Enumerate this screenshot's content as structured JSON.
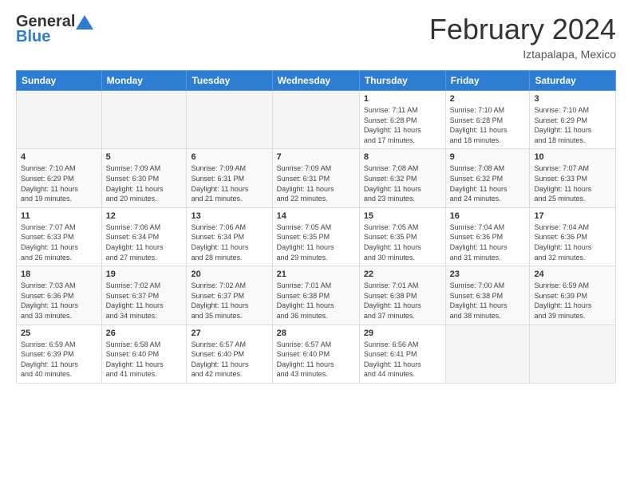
{
  "header": {
    "logo_general": "General",
    "logo_blue": "Blue",
    "main_title": "February 2024",
    "subtitle": "Iztapalapa, Mexico"
  },
  "days_of_week": [
    "Sunday",
    "Monday",
    "Tuesday",
    "Wednesday",
    "Thursday",
    "Friday",
    "Saturday"
  ],
  "weeks": [
    {
      "row_class": "row-1",
      "days": [
        {
          "number": "",
          "info": "",
          "empty": true
        },
        {
          "number": "",
          "info": "",
          "empty": true
        },
        {
          "number": "",
          "info": "",
          "empty": true
        },
        {
          "number": "",
          "info": "",
          "empty": true
        },
        {
          "number": "1",
          "info": "Sunrise: 7:11 AM\nSunset: 6:28 PM\nDaylight: 11 hours\nand 17 minutes.",
          "empty": false
        },
        {
          "number": "2",
          "info": "Sunrise: 7:10 AM\nSunset: 6:28 PM\nDaylight: 11 hours\nand 18 minutes.",
          "empty": false
        },
        {
          "number": "3",
          "info": "Sunrise: 7:10 AM\nSunset: 6:29 PM\nDaylight: 11 hours\nand 18 minutes.",
          "empty": false
        }
      ]
    },
    {
      "row_class": "row-2",
      "days": [
        {
          "number": "4",
          "info": "Sunrise: 7:10 AM\nSunset: 6:29 PM\nDaylight: 11 hours\nand 19 minutes.",
          "empty": false
        },
        {
          "number": "5",
          "info": "Sunrise: 7:09 AM\nSunset: 6:30 PM\nDaylight: 11 hours\nand 20 minutes.",
          "empty": false
        },
        {
          "number": "6",
          "info": "Sunrise: 7:09 AM\nSunset: 6:31 PM\nDaylight: 11 hours\nand 21 minutes.",
          "empty": false
        },
        {
          "number": "7",
          "info": "Sunrise: 7:09 AM\nSunset: 6:31 PM\nDaylight: 11 hours\nand 22 minutes.",
          "empty": false
        },
        {
          "number": "8",
          "info": "Sunrise: 7:08 AM\nSunset: 6:32 PM\nDaylight: 11 hours\nand 23 minutes.",
          "empty": false
        },
        {
          "number": "9",
          "info": "Sunrise: 7:08 AM\nSunset: 6:32 PM\nDaylight: 11 hours\nand 24 minutes.",
          "empty": false
        },
        {
          "number": "10",
          "info": "Sunrise: 7:07 AM\nSunset: 6:33 PM\nDaylight: 11 hours\nand 25 minutes.",
          "empty": false
        }
      ]
    },
    {
      "row_class": "row-3",
      "days": [
        {
          "number": "11",
          "info": "Sunrise: 7:07 AM\nSunset: 6:33 PM\nDaylight: 11 hours\nand 26 minutes.",
          "empty": false
        },
        {
          "number": "12",
          "info": "Sunrise: 7:06 AM\nSunset: 6:34 PM\nDaylight: 11 hours\nand 27 minutes.",
          "empty": false
        },
        {
          "number": "13",
          "info": "Sunrise: 7:06 AM\nSunset: 6:34 PM\nDaylight: 11 hours\nand 28 minutes.",
          "empty": false
        },
        {
          "number": "14",
          "info": "Sunrise: 7:05 AM\nSunset: 6:35 PM\nDaylight: 11 hours\nand 29 minutes.",
          "empty": false
        },
        {
          "number": "15",
          "info": "Sunrise: 7:05 AM\nSunset: 6:35 PM\nDaylight: 11 hours\nand 30 minutes.",
          "empty": false
        },
        {
          "number": "16",
          "info": "Sunrise: 7:04 AM\nSunset: 6:36 PM\nDaylight: 11 hours\nand 31 minutes.",
          "empty": false
        },
        {
          "number": "17",
          "info": "Sunrise: 7:04 AM\nSunset: 6:36 PM\nDaylight: 11 hours\nand 32 minutes.",
          "empty": false
        }
      ]
    },
    {
      "row_class": "row-4",
      "days": [
        {
          "number": "18",
          "info": "Sunrise: 7:03 AM\nSunset: 6:36 PM\nDaylight: 11 hours\nand 33 minutes.",
          "empty": false
        },
        {
          "number": "19",
          "info": "Sunrise: 7:02 AM\nSunset: 6:37 PM\nDaylight: 11 hours\nand 34 minutes.",
          "empty": false
        },
        {
          "number": "20",
          "info": "Sunrise: 7:02 AM\nSunset: 6:37 PM\nDaylight: 11 hours\nand 35 minutes.",
          "empty": false
        },
        {
          "number": "21",
          "info": "Sunrise: 7:01 AM\nSunset: 6:38 PM\nDaylight: 11 hours\nand 36 minutes.",
          "empty": false
        },
        {
          "number": "22",
          "info": "Sunrise: 7:01 AM\nSunset: 6:38 PM\nDaylight: 11 hours\nand 37 minutes.",
          "empty": false
        },
        {
          "number": "23",
          "info": "Sunrise: 7:00 AM\nSunset: 6:38 PM\nDaylight: 11 hours\nand 38 minutes.",
          "empty": false
        },
        {
          "number": "24",
          "info": "Sunrise: 6:59 AM\nSunset: 6:39 PM\nDaylight: 11 hours\nand 39 minutes.",
          "empty": false
        }
      ]
    },
    {
      "row_class": "row-5",
      "days": [
        {
          "number": "25",
          "info": "Sunrise: 6:59 AM\nSunset: 6:39 PM\nDaylight: 11 hours\nand 40 minutes.",
          "empty": false
        },
        {
          "number": "26",
          "info": "Sunrise: 6:58 AM\nSunset: 6:40 PM\nDaylight: 11 hours\nand 41 minutes.",
          "empty": false
        },
        {
          "number": "27",
          "info": "Sunrise: 6:57 AM\nSunset: 6:40 PM\nDaylight: 11 hours\nand 42 minutes.",
          "empty": false
        },
        {
          "number": "28",
          "info": "Sunrise: 6:57 AM\nSunset: 6:40 PM\nDaylight: 11 hours\nand 43 minutes.",
          "empty": false
        },
        {
          "number": "29",
          "info": "Sunrise: 6:56 AM\nSunset: 6:41 PM\nDaylight: 11 hours\nand 44 minutes.",
          "empty": false
        },
        {
          "number": "",
          "info": "",
          "empty": true
        },
        {
          "number": "",
          "info": "",
          "empty": true
        }
      ]
    }
  ]
}
